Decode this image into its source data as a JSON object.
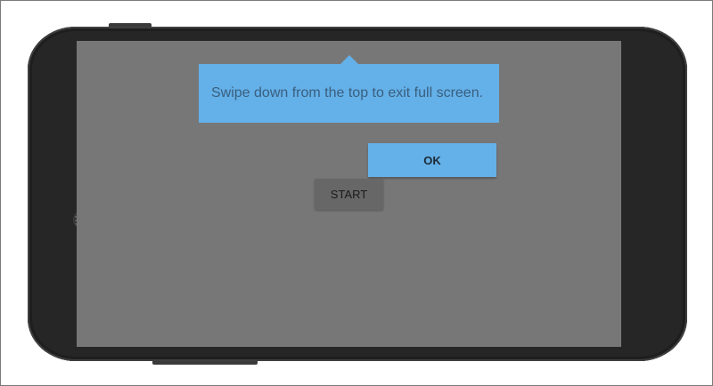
{
  "tooltip": {
    "message": "Swipe down from the top to exit full screen."
  },
  "dialog": {
    "ok_label": "OK"
  },
  "app": {
    "start_label": "START"
  },
  "colors": {
    "tooltip_background": "#64b0e8",
    "screen_background": "#777777",
    "phone_body": "#262626",
    "start_button": "#676767"
  }
}
